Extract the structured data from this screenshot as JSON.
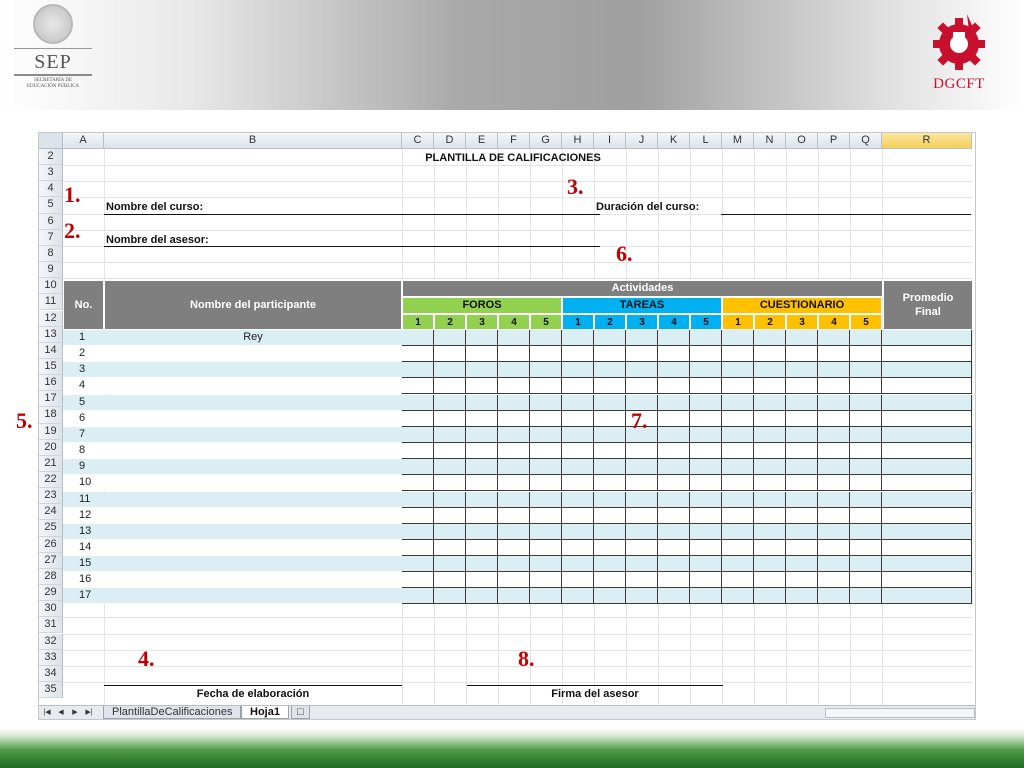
{
  "header": {
    "left_logo": {
      "name": "SEP",
      "line1": "SECRETARÍA DE",
      "line2": "EDUCACIÓN PÚBLICA"
    },
    "right_logo": {
      "name": "DGCFT"
    }
  },
  "sheet": {
    "columns": [
      "A",
      "B",
      "C",
      "D",
      "E",
      "F",
      "G",
      "H",
      "I",
      "J",
      "K",
      "L",
      "M",
      "N",
      "O",
      "P",
      "Q",
      "R"
    ],
    "rows": [
      "2",
      "3",
      "4",
      "5",
      "6",
      "7",
      "8",
      "9",
      "10",
      "11",
      "12",
      "13",
      "14",
      "15",
      "16",
      "17",
      "18",
      "19",
      "20",
      "21",
      "22",
      "23",
      "24",
      "25",
      "26",
      "27",
      "28",
      "29",
      "30",
      "31",
      "32",
      "33",
      "34",
      "35"
    ],
    "selected_column": "R",
    "title": "PLANTILLA DE CALIFICACIONES",
    "course_name_label": "Nombre del curso:",
    "duration_label": "Duración del curso:",
    "advisor_label": "Nombre del asesor:",
    "table": {
      "no_header": "No.",
      "name_header": "Nombre del participante",
      "activities_header": "Actividades",
      "groups": [
        {
          "label": "FOROS",
          "color": "#92d050"
        },
        {
          "label": "TAREAS",
          "color": "#00b0f0"
        },
        {
          "label": "CUESTIONARIO",
          "color": "#ffc000"
        }
      ],
      "sub_numbers": [
        "1",
        "2",
        "3",
        "4",
        "5"
      ],
      "average_header_l1": "Promedio",
      "average_header_l2": "Final",
      "row_fill_alt": "#daeef3",
      "participants": [
        {
          "no": "1",
          "name": "Rey"
        },
        {
          "no": "2",
          "name": ""
        },
        {
          "no": "3",
          "name": ""
        },
        {
          "no": "4",
          "name": ""
        },
        {
          "no": "5",
          "name": ""
        },
        {
          "no": "6",
          "name": ""
        },
        {
          "no": "7",
          "name": ""
        },
        {
          "no": "8",
          "name": ""
        },
        {
          "no": "9",
          "name": ""
        },
        {
          "no": "10",
          "name": ""
        },
        {
          "no": "11",
          "name": ""
        },
        {
          "no": "12",
          "name": ""
        },
        {
          "no": "13",
          "name": ""
        },
        {
          "no": "14",
          "name": ""
        },
        {
          "no": "15",
          "name": ""
        },
        {
          "no": "16",
          "name": ""
        },
        {
          "no": "17",
          "name": ""
        }
      ]
    },
    "date_label": "Fecha de elaboración",
    "signature_label": "Firma del asesor",
    "tabs": [
      {
        "label": "PlantillaDeCalificaciones",
        "active": false
      },
      {
        "label": "Hoja1",
        "active": true
      }
    ]
  },
  "markers": [
    "1.",
    "2.",
    "3.",
    "4.",
    "5.",
    "6.",
    "7.",
    "8."
  ]
}
